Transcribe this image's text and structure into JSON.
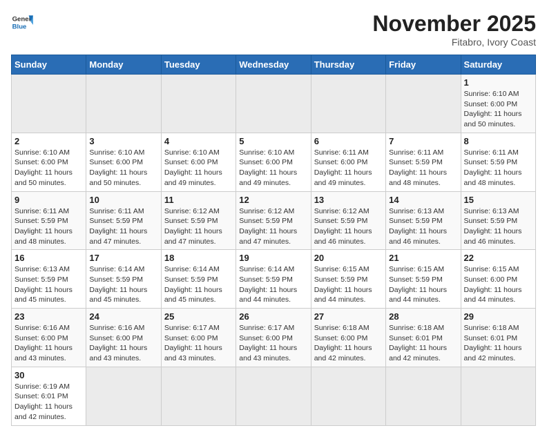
{
  "header": {
    "logo_general": "General",
    "logo_blue": "Blue",
    "month_title": "November 2025",
    "location": "Fitabro, Ivory Coast"
  },
  "weekdays": [
    "Sunday",
    "Monday",
    "Tuesday",
    "Wednesday",
    "Thursday",
    "Friday",
    "Saturday"
  ],
  "weeks": [
    [
      {
        "day": "",
        "info": ""
      },
      {
        "day": "",
        "info": ""
      },
      {
        "day": "",
        "info": ""
      },
      {
        "day": "",
        "info": ""
      },
      {
        "day": "",
        "info": ""
      },
      {
        "day": "",
        "info": ""
      },
      {
        "day": "1",
        "info": "Sunrise: 6:10 AM\nSunset: 6:00 PM\nDaylight: 11 hours\nand 50 minutes."
      }
    ],
    [
      {
        "day": "2",
        "info": "Sunrise: 6:10 AM\nSunset: 6:00 PM\nDaylight: 11 hours\nand 50 minutes."
      },
      {
        "day": "3",
        "info": "Sunrise: 6:10 AM\nSunset: 6:00 PM\nDaylight: 11 hours\nand 50 minutes."
      },
      {
        "day": "4",
        "info": "Sunrise: 6:10 AM\nSunset: 6:00 PM\nDaylight: 11 hours\nand 49 minutes."
      },
      {
        "day": "5",
        "info": "Sunrise: 6:10 AM\nSunset: 6:00 PM\nDaylight: 11 hours\nand 49 minutes."
      },
      {
        "day": "6",
        "info": "Sunrise: 6:11 AM\nSunset: 6:00 PM\nDaylight: 11 hours\nand 49 minutes."
      },
      {
        "day": "7",
        "info": "Sunrise: 6:11 AM\nSunset: 5:59 PM\nDaylight: 11 hours\nand 48 minutes."
      },
      {
        "day": "8",
        "info": "Sunrise: 6:11 AM\nSunset: 5:59 PM\nDaylight: 11 hours\nand 48 minutes."
      }
    ],
    [
      {
        "day": "9",
        "info": "Sunrise: 6:11 AM\nSunset: 5:59 PM\nDaylight: 11 hours\nand 48 minutes."
      },
      {
        "day": "10",
        "info": "Sunrise: 6:11 AM\nSunset: 5:59 PM\nDaylight: 11 hours\nand 47 minutes."
      },
      {
        "day": "11",
        "info": "Sunrise: 6:12 AM\nSunset: 5:59 PM\nDaylight: 11 hours\nand 47 minutes."
      },
      {
        "day": "12",
        "info": "Sunrise: 6:12 AM\nSunset: 5:59 PM\nDaylight: 11 hours\nand 47 minutes."
      },
      {
        "day": "13",
        "info": "Sunrise: 6:12 AM\nSunset: 5:59 PM\nDaylight: 11 hours\nand 46 minutes."
      },
      {
        "day": "14",
        "info": "Sunrise: 6:13 AM\nSunset: 5:59 PM\nDaylight: 11 hours\nand 46 minutes."
      },
      {
        "day": "15",
        "info": "Sunrise: 6:13 AM\nSunset: 5:59 PM\nDaylight: 11 hours\nand 46 minutes."
      }
    ],
    [
      {
        "day": "16",
        "info": "Sunrise: 6:13 AM\nSunset: 5:59 PM\nDaylight: 11 hours\nand 45 minutes."
      },
      {
        "day": "17",
        "info": "Sunrise: 6:14 AM\nSunset: 5:59 PM\nDaylight: 11 hours\nand 45 minutes."
      },
      {
        "day": "18",
        "info": "Sunrise: 6:14 AM\nSunset: 5:59 PM\nDaylight: 11 hours\nand 45 minutes."
      },
      {
        "day": "19",
        "info": "Sunrise: 6:14 AM\nSunset: 5:59 PM\nDaylight: 11 hours\nand 44 minutes."
      },
      {
        "day": "20",
        "info": "Sunrise: 6:15 AM\nSunset: 5:59 PM\nDaylight: 11 hours\nand 44 minutes."
      },
      {
        "day": "21",
        "info": "Sunrise: 6:15 AM\nSunset: 5:59 PM\nDaylight: 11 hours\nand 44 minutes."
      },
      {
        "day": "22",
        "info": "Sunrise: 6:15 AM\nSunset: 6:00 PM\nDaylight: 11 hours\nand 44 minutes."
      }
    ],
    [
      {
        "day": "23",
        "info": "Sunrise: 6:16 AM\nSunset: 6:00 PM\nDaylight: 11 hours\nand 43 minutes."
      },
      {
        "day": "24",
        "info": "Sunrise: 6:16 AM\nSunset: 6:00 PM\nDaylight: 11 hours\nand 43 minutes."
      },
      {
        "day": "25",
        "info": "Sunrise: 6:17 AM\nSunset: 6:00 PM\nDaylight: 11 hours\nand 43 minutes."
      },
      {
        "day": "26",
        "info": "Sunrise: 6:17 AM\nSunset: 6:00 PM\nDaylight: 11 hours\nand 43 minutes."
      },
      {
        "day": "27",
        "info": "Sunrise: 6:18 AM\nSunset: 6:00 PM\nDaylight: 11 hours\nand 42 minutes."
      },
      {
        "day": "28",
        "info": "Sunrise: 6:18 AM\nSunset: 6:01 PM\nDaylight: 11 hours\nand 42 minutes."
      },
      {
        "day": "29",
        "info": "Sunrise: 6:18 AM\nSunset: 6:01 PM\nDaylight: 11 hours\nand 42 minutes."
      }
    ],
    [
      {
        "day": "30",
        "info": "Sunrise: 6:19 AM\nSunset: 6:01 PM\nDaylight: 11 hours\nand 42 minutes."
      },
      {
        "day": "",
        "info": ""
      },
      {
        "day": "",
        "info": ""
      },
      {
        "day": "",
        "info": ""
      },
      {
        "day": "",
        "info": ""
      },
      {
        "day": "",
        "info": ""
      },
      {
        "day": "",
        "info": ""
      }
    ]
  ]
}
